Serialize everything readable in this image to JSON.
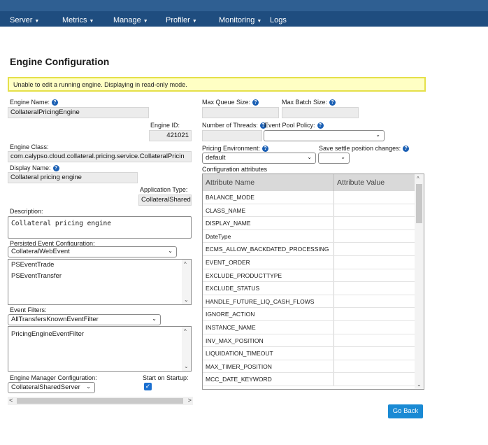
{
  "nav": {
    "items": [
      {
        "label": "Server",
        "dropdown": true
      },
      {
        "label": "Metrics",
        "dropdown": true
      },
      {
        "label": "Manage",
        "dropdown": true
      },
      {
        "label": "Profiler",
        "dropdown": true
      },
      {
        "label": "Monitoring",
        "dropdown": true
      },
      {
        "label": "Logs",
        "dropdown": false
      }
    ]
  },
  "page_title": "Engine Configuration",
  "alert": "Unable to edit a running engine. Displaying in read-only mode.",
  "form": {
    "engine_name_label": "Engine Name:",
    "engine_name": "CollateralPricingEngine",
    "engine_id_label": "Engine ID:",
    "engine_id": "421021",
    "engine_class_label": "Engine Class:",
    "engine_class": "com.calypso.cloud.collateral.pricing.service.CollateralPricin",
    "display_name_label": "Display Name:",
    "display_name": "Collateral pricing engine",
    "application_type_label": "Application Type:",
    "application_type": "CollateralSharedS",
    "description_label": "Description:",
    "description": "Collateral pricing engine",
    "persisted_event_label": "Persisted Event Configuration:",
    "persisted_event_selected": "CollateralWebEvent",
    "persisted_events": [
      "PSEventTrade",
      "PSEventTransfer"
    ],
    "event_filters_label": "Event Filters:",
    "event_filter_selected": "AllTransfersKnownEventFilter",
    "event_filters": [
      "PricingEngineEventFilter"
    ],
    "engine_manager_label": "Engine Manager Configuration:",
    "engine_manager_selected": "CollateralSharedServer",
    "start_on_startup_label": "Start on Startup:",
    "start_on_startup": true,
    "max_queue_label": "Max Queue Size:",
    "max_queue": "",
    "max_batch_label": "Max Batch Size:",
    "max_batch": "",
    "threads_label": "Number of Threads:",
    "threads": "",
    "event_pool_label": "Event Pool Policy:",
    "event_pool_selected": "",
    "pricing_env_label": "Pricing Environment:",
    "pricing_env_selected": "default",
    "save_settle_label": "Save settle position changes:",
    "save_settle_selected": "",
    "config_attrs_label": "Configuration attributes"
  },
  "attributes": {
    "headers": [
      "Attribute Name",
      "Attribute Value"
    ],
    "rows": [
      "BALANCE_MODE",
      "CLASS_NAME",
      "DISPLAY_NAME",
      "DateType",
      "ECMS_ALLOW_BACKDATED_PROCESSING",
      "EVENT_ORDER",
      "EXCLUDE_PRODUCTTYPE",
      "EXCLUDE_STATUS",
      "HANDLE_FUTURE_LIQ_CASH_FLOWS",
      "IGNORE_ACTION",
      "INSTANCE_NAME",
      "INV_MAX_POSITION",
      "LIQUIDATION_TIMEOUT",
      "MAX_TIMER_POSITION",
      "MCC_DATE_KEYWORD"
    ]
  },
  "go_back_label": "Go Back",
  "colors": {
    "navbar": "#1f4d7f",
    "alert_bg": "#ffffc4",
    "alert_border": "#e5e04a",
    "help_icon": "#1a5fb4",
    "button": "#1a8ad4"
  }
}
